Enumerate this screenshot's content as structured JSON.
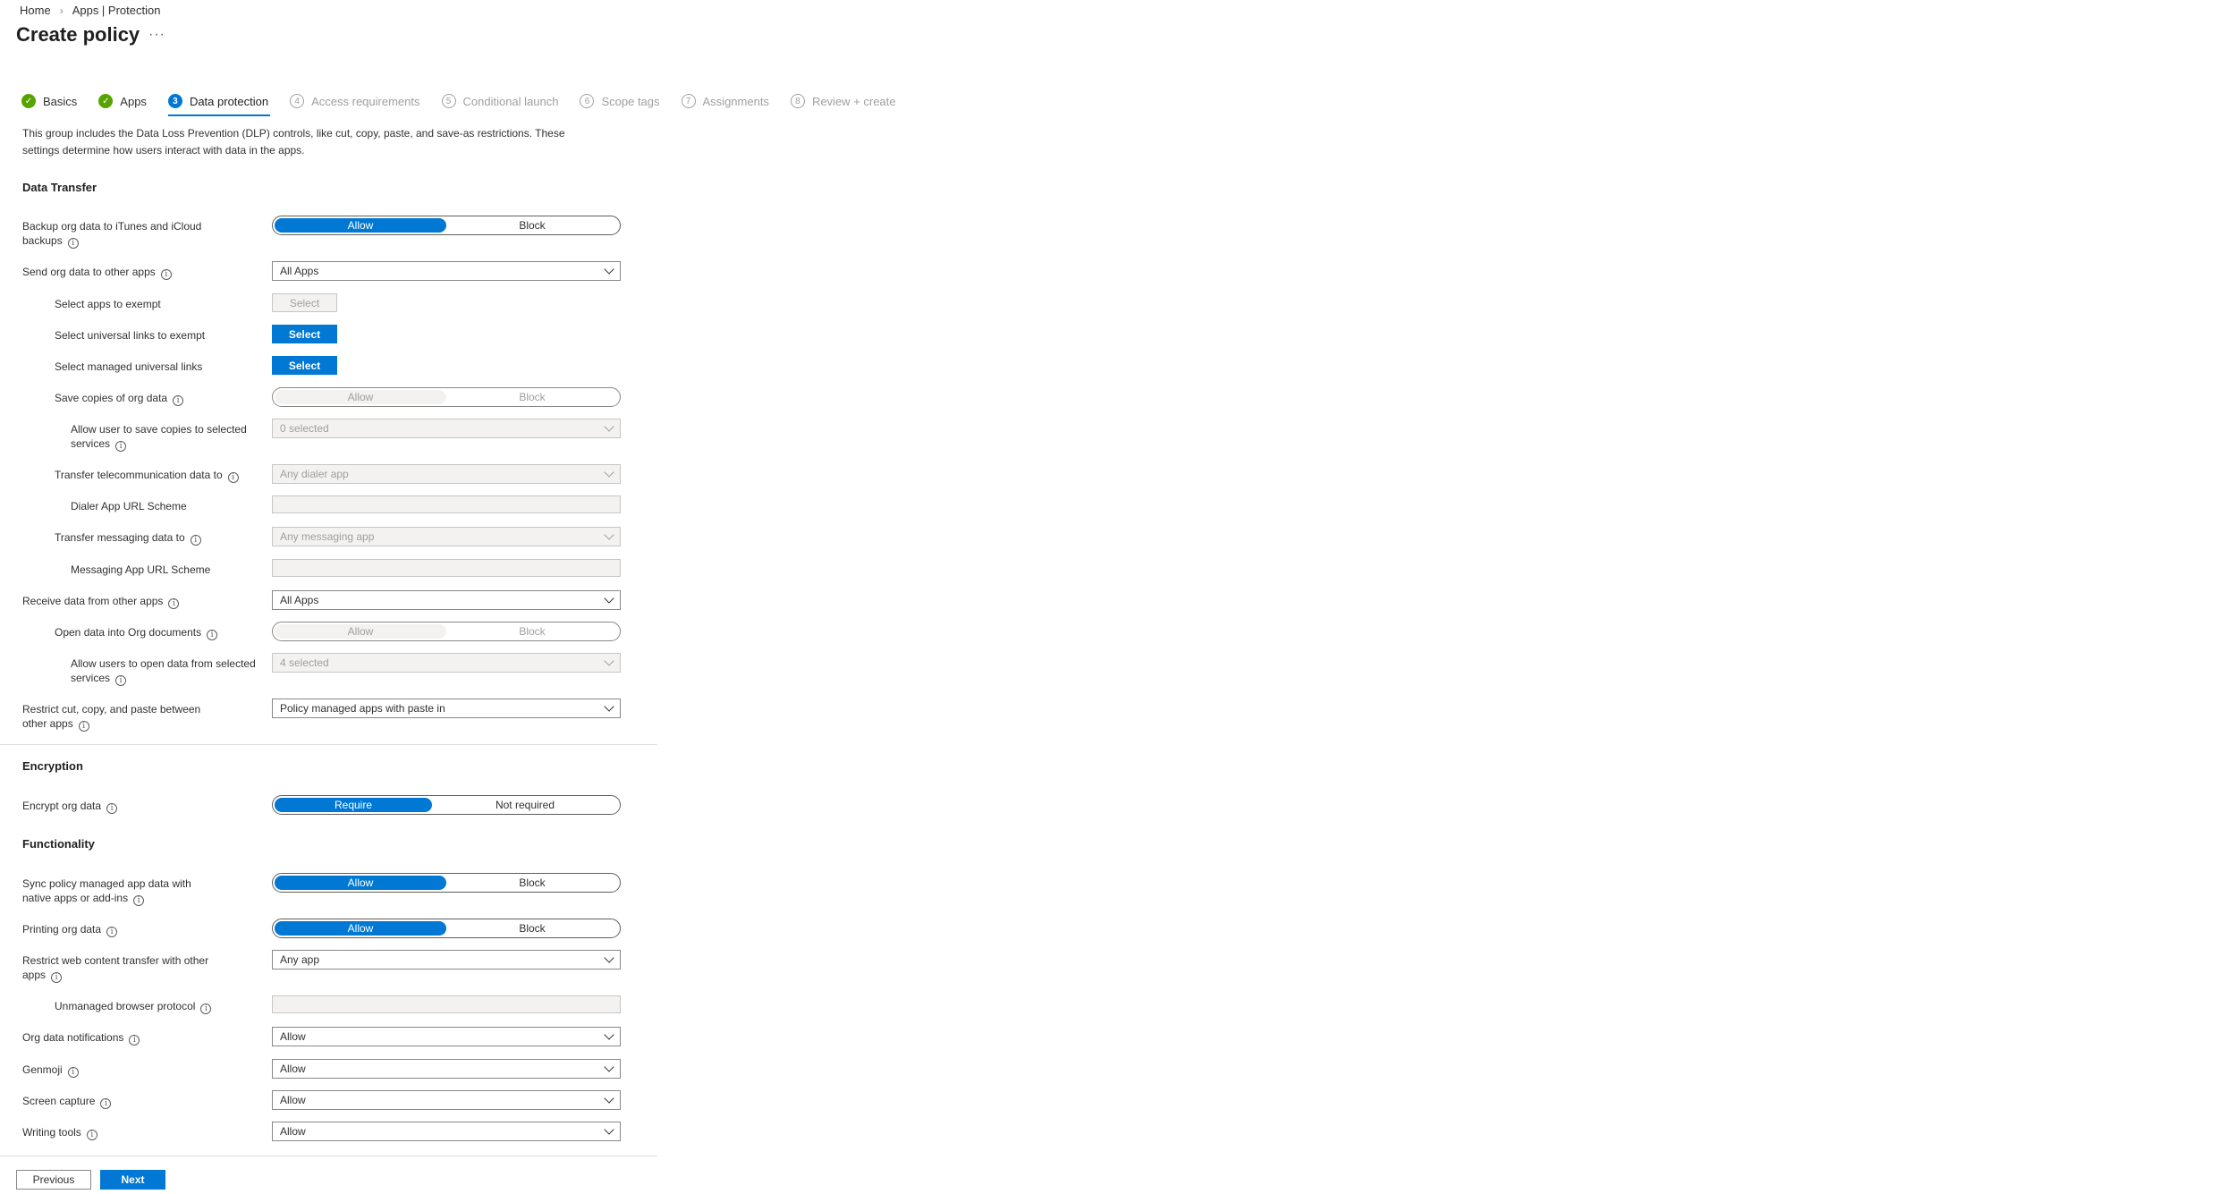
{
  "breadcrumb": {
    "home": "Home",
    "sep": "›",
    "current": "Apps | Protection"
  },
  "title": "Create policy",
  "more_label": "···",
  "steps": [
    {
      "num": "✓",
      "label": "Basics"
    },
    {
      "num": "✓",
      "label": "Apps"
    },
    {
      "num": "3",
      "label": "Data protection"
    },
    {
      "num": "4",
      "label": "Access requirements"
    },
    {
      "num": "5",
      "label": "Conditional launch"
    },
    {
      "num": "6",
      "label": "Scope tags"
    },
    {
      "num": "7",
      "label": "Assignments"
    },
    {
      "num": "8",
      "label": "Review + create"
    }
  ],
  "intro": "This group includes the Data Loss Prevention (DLP) controls, like cut, copy, paste, and save-as restrictions. These settings determine how users interact with data in the apps.",
  "info_glyph": "i",
  "data_transfer": {
    "heading": "Data Transfer",
    "backup_label": "Backup org data to iTunes and iCloud backups",
    "backup_allow": "Allow",
    "backup_block": "Block",
    "send_label": "Send org data to other apps",
    "send_value": "All Apps",
    "exempt_apps_label": "Select apps to exempt",
    "exempt_apps_btn": "Select",
    "exempt_links_label": "Select universal links to exempt",
    "exempt_links_btn": "Select",
    "managed_links_label": "Select managed universal links",
    "managed_links_btn": "Select",
    "save_copies_label": "Save copies of org data",
    "save_copies_allow": "Allow",
    "save_copies_block": "Block",
    "save_services_label": "Allow user to save copies to selected services",
    "save_services_value": "0 selected",
    "telecom_label": "Transfer telecommunication data to",
    "telecom_value": "Any dialer app",
    "dialer_label": "Dialer App URL Scheme",
    "messaging_label": "Transfer messaging data to",
    "messaging_value": "Any messaging app",
    "messaging_scheme_label": "Messaging App URL Scheme",
    "receive_label": "Receive data from other apps",
    "receive_value": "All Apps",
    "open_org_label": "Open data into Org documents",
    "open_org_allow": "Allow",
    "open_org_block": "Block",
    "open_services_label": "Allow users to open data from selected services",
    "open_services_value": "4 selected",
    "restrict_label": "Restrict cut, copy, and paste between other apps",
    "restrict_value": "Policy managed apps with paste in"
  },
  "encryption": {
    "heading": "Encryption",
    "encrypt_label": "Encrypt org data",
    "require": "Require",
    "not_required": "Not required"
  },
  "functionality": {
    "heading": "Functionality",
    "sync_label": "Sync policy managed app data with native apps or add-ins",
    "sync_allow": "Allow",
    "sync_block": "Block",
    "printing_label": "Printing org data",
    "printing_allow": "Allow",
    "printing_block": "Block",
    "web_label": "Restrict web content transfer with other apps",
    "web_value": "Any app",
    "browser_label": "Unmanaged browser protocol",
    "notifications_label": "Org data notifications",
    "notifications_value": "Allow",
    "genmoji_label": "Genmoji",
    "genmoji_value": "Allow",
    "screen_label": "Screen capture",
    "screen_value": "Allow",
    "writing_label": "Writing tools",
    "writing_value": "Allow"
  },
  "footer": {
    "previous": "Previous",
    "next": "Next"
  }
}
